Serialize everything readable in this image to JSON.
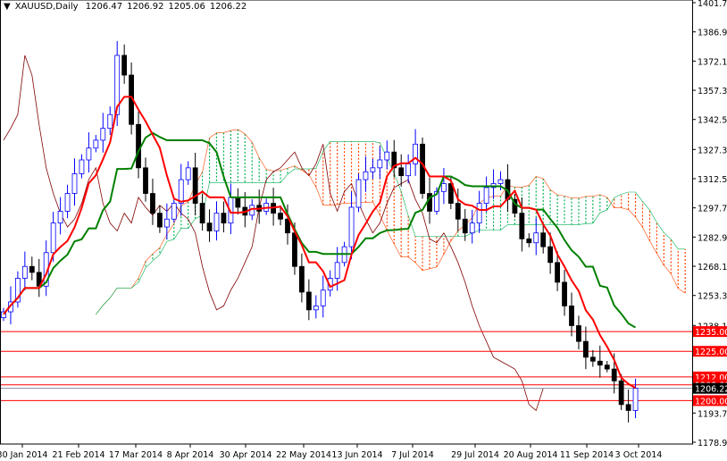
{
  "header": {
    "symbol": "XAUUSD,Daily",
    "open": "1206.47",
    "high": "1206.92",
    "low": "1205.06",
    "close": "1206.22"
  },
  "chart_data": {
    "type": "candlestick",
    "title": "XAUUSD,Daily",
    "ylim": [
      1178.9,
      1401.7
    ],
    "y_ticks": [
      "1401.70",
      "1386.90",
      "1372.10",
      "1357.30",
      "1342.50",
      "1327.30",
      "1312.50",
      "1297.70",
      "1282.90",
      "1268.10",
      "1253.30",
      "1238.10",
      "1193.70",
      "1178.90"
    ],
    "x_ticks": [
      "30 Jan 2014",
      "21 Feb 2014",
      "17 Mar 2014",
      "8 Apr 2014",
      "30 Apr 2014",
      "22 May 2014",
      "13 Jun 2014",
      "7 Jul 2014",
      "29 Jul 2014",
      "20 Aug 2014",
      "11 Sep 2014",
      "3 Oct 2014"
    ],
    "closes": [
      1245,
      1250,
      1262,
      1268,
      1265,
      1258,
      1275,
      1290,
      1296,
      1305,
      1315,
      1322,
      1328,
      1332,
      1338,
      1345,
      1375,
      1365,
      1340,
      1318,
      1305,
      1295,
      1288,
      1292,
      1300,
      1312,
      1318,
      1300,
      1290,
      1286,
      1295,
      1290,
      1303,
      1298,
      1294,
      1299,
      1296,
      1300,
      1295,
      1292,
      1285,
      1268,
      1255,
      1246,
      1248,
      1256,
      1262,
      1270,
      1278,
      1298,
      1312,
      1316,
      1318,
      1322,
      1326,
      1318,
      1314,
      1320,
      1330,
      1305,
      1296,
      1306,
      1310,
      1300,
      1292,
      1285,
      1290,
      1300,
      1308,
      1310,
      1312,
      1302,
      1295,
      1282,
      1280,
      1285,
      1278,
      1270,
      1260,
      1248,
      1238,
      1230,
      1222,
      1220,
      1218,
      1216,
      1210,
      1198,
      1195,
      1206.22
    ],
    "levels": [
      {
        "value": 1235,
        "label": "1235.00"
      },
      {
        "value": 1225,
        "label": "1225.00"
      },
      {
        "value": 1212,
        "label": "1212.00"
      },
      {
        "value": 1208,
        "label": "1208.00"
      },
      {
        "value": 1200,
        "label": "1200.00"
      }
    ],
    "current_price": {
      "value": 1206.22,
      "label": "1206.22"
    },
    "colors": {
      "bull": "#0000ff",
      "bear": "#000000",
      "tenkan": "#ff0000",
      "kijun": "#008000",
      "chikou": "#800000",
      "cloud_up": "#00b050",
      "cloud_down": "#ff4500",
      "level": "#ff0000"
    }
  }
}
